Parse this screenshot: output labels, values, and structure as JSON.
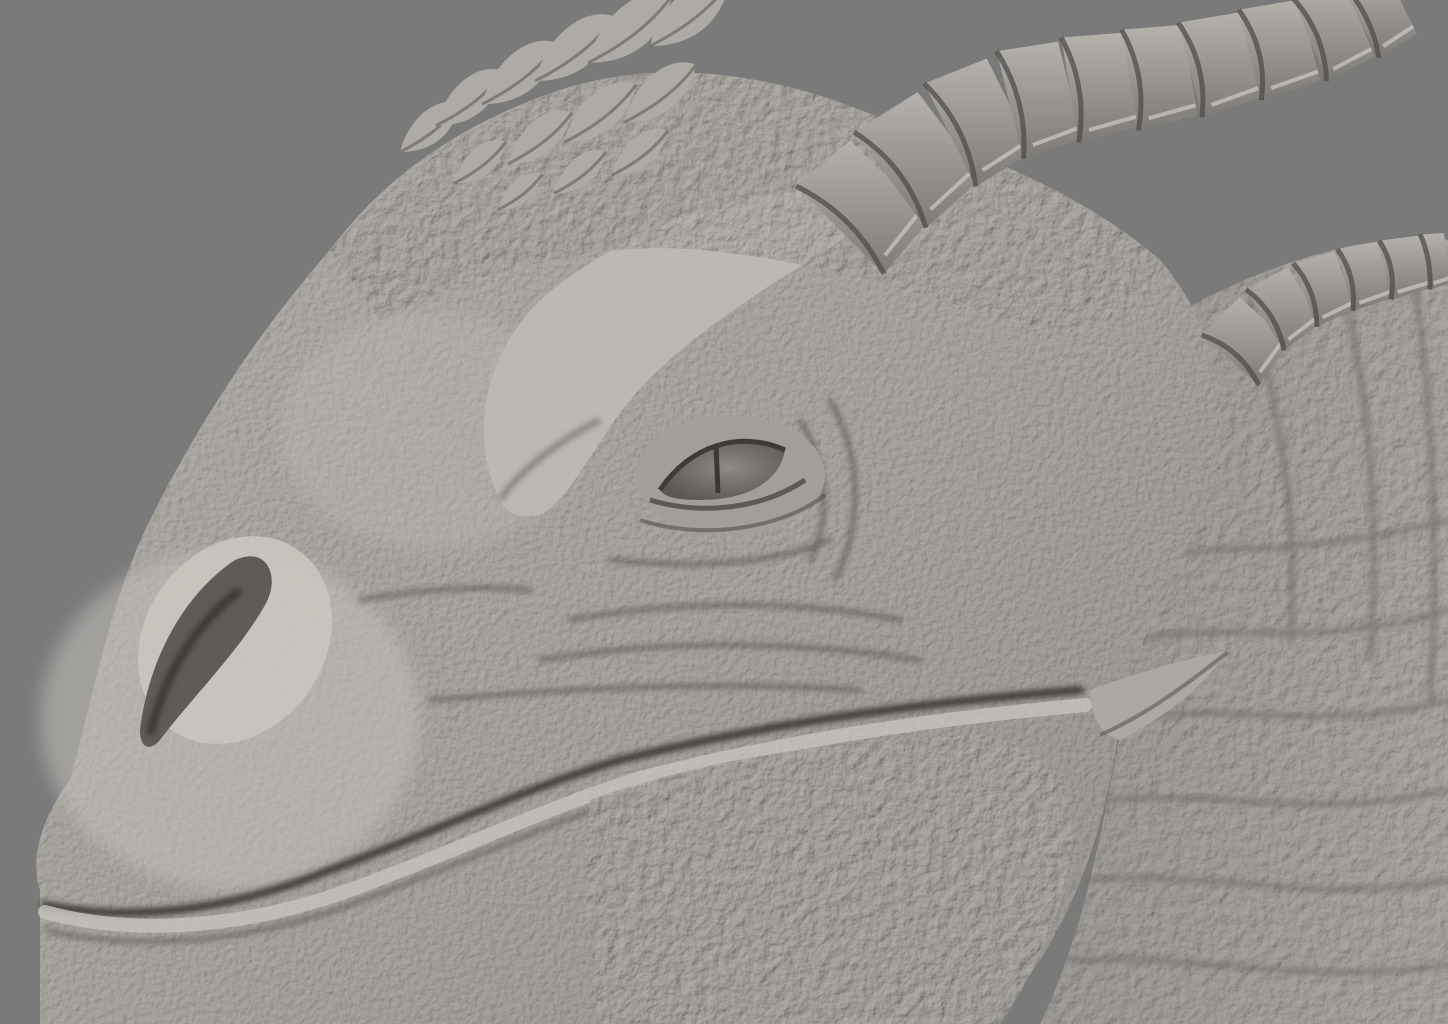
{
  "scene": {
    "background": "#7a7a7a",
    "clay_light": "#b7b3ae",
    "clay_mid": "#9d9994",
    "clay_dark": "#5e5b58",
    "crease": "#3f3d3b"
  }
}
